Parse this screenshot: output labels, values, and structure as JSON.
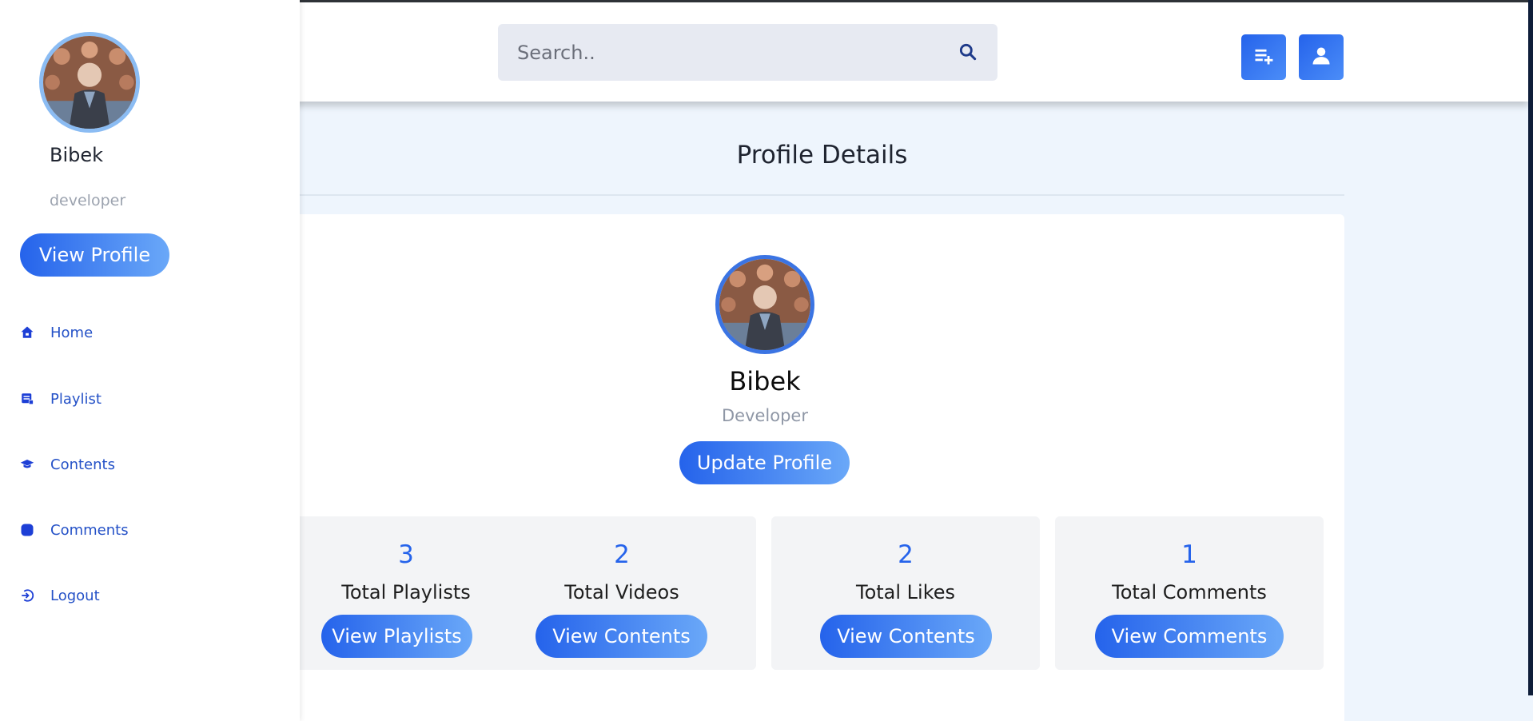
{
  "search": {
    "placeholder": "Search.."
  },
  "header": {
    "buttons": [
      {
        "icon": "playlist-add-icon"
      },
      {
        "icon": "user-icon"
      }
    ]
  },
  "sidebar": {
    "user_name": "Bibek",
    "user_role": "developer",
    "view_profile_label": "View Profile",
    "items": [
      {
        "label": "Home",
        "icon": "home-icon"
      },
      {
        "label": "Playlist",
        "icon": "playlist-icon"
      },
      {
        "label": "Contents",
        "icon": "graduation-cap-icon"
      },
      {
        "label": "Comments",
        "icon": "comment-icon"
      },
      {
        "label": "Logout",
        "icon": "logout-icon"
      }
    ]
  },
  "main": {
    "title": "Profile Details",
    "profile": {
      "name": "Bibek",
      "role": "Developer",
      "update_label": "Update Profile"
    },
    "stats": [
      {
        "value": "3",
        "label": "Total Playlists",
        "button": "View Playlists"
      },
      {
        "value": "2",
        "label": "Total Videos",
        "button": "View Contents"
      },
      {
        "value": "2",
        "label": "Total Likes",
        "button": "View Contents"
      },
      {
        "value": "1",
        "label": "Total Comments",
        "button": "View Comments"
      }
    ]
  },
  "colors": {
    "accent": "#2563eb",
    "accent_light": "#6aa8f8",
    "nav_text": "#2451c7",
    "background": "#eef5fd"
  }
}
